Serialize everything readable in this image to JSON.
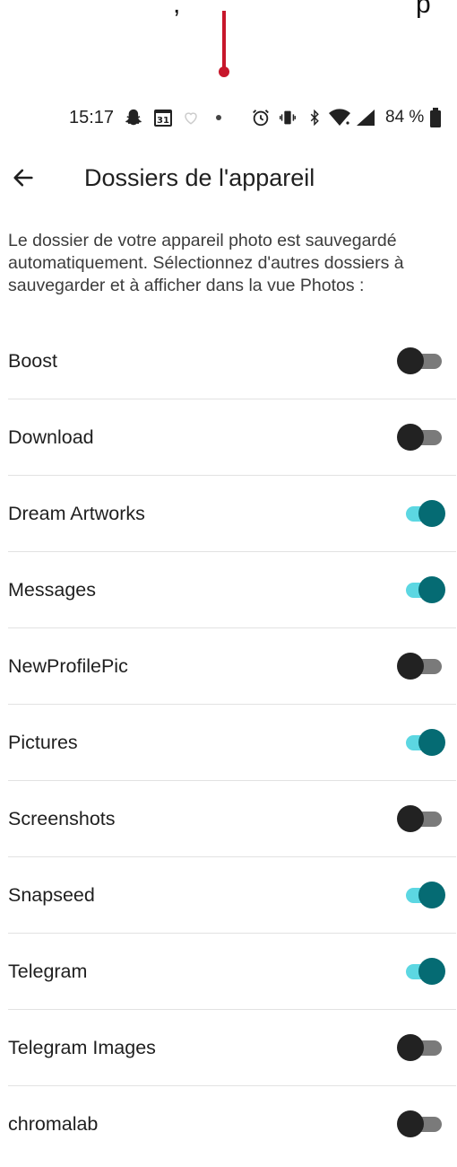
{
  "caption": {
    "left": ",",
    "right": "p"
  },
  "status_bar": {
    "time": "15:17",
    "calendar_day": "31",
    "battery_text": "84 %",
    "icons": [
      "snapchat-icon",
      "calendar-icon",
      "heart-icon",
      "dot-icon",
      "alarm-icon",
      "vibrate-icon",
      "bluetooth-icon",
      "wifi-icon",
      "cell-signal-icon",
      "battery-icon"
    ]
  },
  "header": {
    "title": "Dossiers de l'appareil",
    "back_icon": "arrow-left-icon"
  },
  "intro_text": "Le dossier de votre appareil photo est sauvegardé automatiquement. Sélectionnez d'autres dossiers à sauvegarder et à afficher dans la vue Photos :",
  "folders": [
    {
      "name": "Boost",
      "enabled": false
    },
    {
      "name": "Download",
      "enabled": false
    },
    {
      "name": "Dream Artworks",
      "enabled": true
    },
    {
      "name": "Messages",
      "enabled": true
    },
    {
      "name": "NewProfilePic",
      "enabled": false
    },
    {
      "name": "Pictures",
      "enabled": true
    },
    {
      "name": "Screenshots",
      "enabled": false
    },
    {
      "name": "Snapseed",
      "enabled": true
    },
    {
      "name": "Telegram",
      "enabled": true
    },
    {
      "name": "Telegram Images",
      "enabled": false
    },
    {
      "name": "chromalab",
      "enabled": false
    }
  ],
  "colors": {
    "toggle_on_track": "#5cd7e2",
    "toggle_on_thumb": "#056b73",
    "toggle_off_track": "#7a7a7a",
    "toggle_off_thumb": "#222222",
    "marker": "#c7172b"
  }
}
